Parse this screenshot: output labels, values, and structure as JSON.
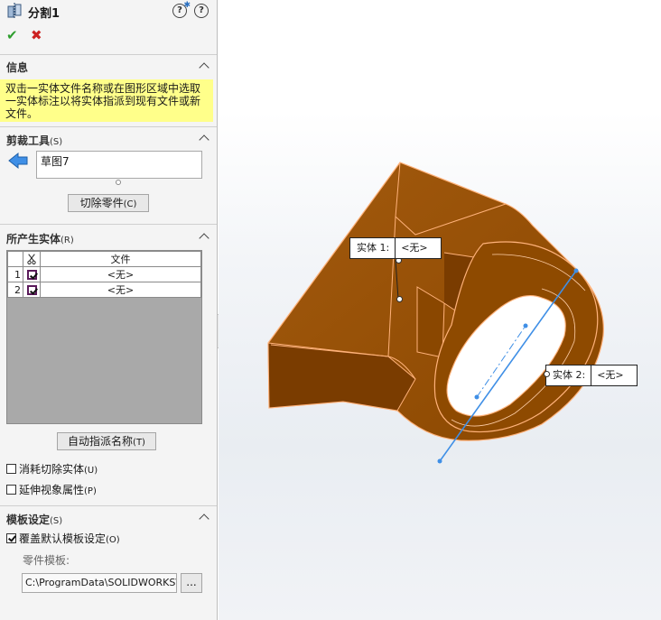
{
  "feature": {
    "title": "分割1",
    "ok_icon": "checkmark-icon",
    "cancel_icon": "close-icon"
  },
  "info": {
    "title": "信息",
    "message": "双击一实体文件名称或在图形区域中选取一实体标注以将实体指派到现有文件或新文件。"
  },
  "trim_tools": {
    "title": "剪裁工具",
    "key": "(S)",
    "selection": "草图7",
    "cut_button": "切除零件",
    "cut_key": "(C)"
  },
  "resulting_bodies": {
    "title": "所产生实体",
    "key": "(R)",
    "column_header": "文件",
    "rows": [
      {
        "index": "1",
        "file": "<无>",
        "checked": true
      },
      {
        "index": "2",
        "file": "<无>",
        "checked": true
      }
    ],
    "auto_assign_button": "自动指派名称",
    "auto_assign_key": "(T)",
    "consume_cut_label": "消耗切除实体",
    "consume_cut_key": "(U)",
    "propagate_label": "延伸视象属性",
    "propagate_key": "(P)"
  },
  "template": {
    "title": "模板设定",
    "key": "(S)",
    "override_label": "覆盖默认模板设定",
    "override_key": "(O)",
    "override_checked": true,
    "part_template_label": "零件模板:",
    "path": "C:\\ProgramData\\SOLIDWORKS\\S",
    "browse_label": "..."
  },
  "viewport": {
    "callouts": [
      {
        "label": "实体 1:",
        "value": "<无>"
      },
      {
        "label": "实体 2:",
        "value": "<无>"
      }
    ]
  },
  "colors": {
    "part_fill": "#8e4a00",
    "part_edge": "#ffb27a",
    "sketch_line": "#3f8fe6",
    "info_background": "#ffff8a"
  }
}
